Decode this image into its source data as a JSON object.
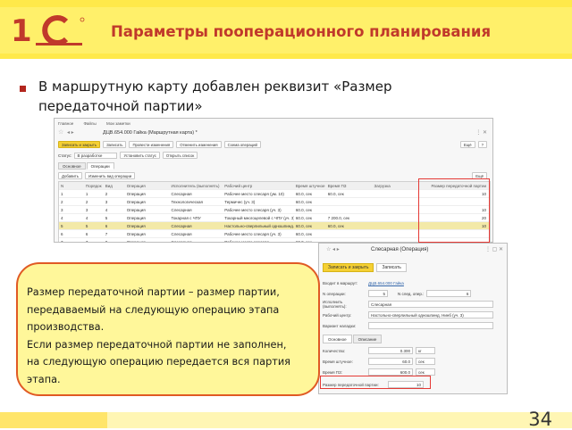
{
  "slide": {
    "title": "Параметры пооперационного планирования",
    "bullet": "В маршрутную карту добавлен реквизит «Размер передаточной партии»",
    "callout": [
      "Размер передаточной партии – размер партии,",
      "передаваемый на следующую операцию этапа",
      "производства.",
      "Если размер передаточной партии не заполнен,",
      "на следующую операцию передается вся партия",
      "этапа."
    ],
    "page_number": "34",
    "colors": {
      "title": "#c0392b",
      "accent": "#f5d033",
      "highlight_border": "#e53935",
      "callout_border": "#e05a24"
    }
  },
  "route_window": {
    "nav": [
      "Главное",
      "Файлы",
      "Мои заметки"
    ],
    "title": "ДЦВ.654.000 Гайка (Маршрутная карта) *",
    "toolbar": [
      "Записать и закрыть",
      "Записать",
      "Провести изменения",
      "Отменить изменения",
      "Схема операций"
    ],
    "toolbar_right": [
      "Ещё",
      "?"
    ],
    "status_label": "Статус:",
    "status_value": "В разработке",
    "status_buttons": [
      "Установить статус",
      "Открыть список"
    ],
    "tabs": [
      "Основное",
      "Операции"
    ],
    "grid_toolbar": [
      "Добавить",
      "Изменить вид операции"
    ],
    "grid_toolbar_right": [
      "Ещё"
    ],
    "columns": [
      "N",
      "Порядок",
      "Вид",
      "Операция",
      "Исполнитель (выполнять)",
      "Рабочий центр",
      "Время штучное",
      "Время ПЗ",
      "Загрузка",
      "Размер передаточной партии"
    ],
    "rows": [
      [
        "1",
        "1",
        "2",
        "Операция",
        "Слесарная",
        "Рабочее место слесаря (ум. 10)",
        "60.0, сек",
        "60.0, сек",
        "",
        "10"
      ],
      [
        "2",
        "2",
        "3",
        "Операция",
        "Технологическая",
        "Термичес (уч. 3)",
        "60.0, сек",
        "",
        "",
        ""
      ],
      [
        "3",
        "3",
        "4",
        "Операция",
        "Слесарная",
        "Рабочее место слесаря (уч. 3)",
        "60.0, сек",
        "",
        "",
        "10"
      ],
      [
        "4",
        "4",
        "5",
        "Операция",
        "Токарная с ЧПУ",
        "Токарный многоцелевой с ЧПУ (уч. 3)",
        "60.0, сек",
        "7 200.0, сек",
        "",
        "20"
      ],
      [
        "5",
        "5",
        "6",
        "Операция",
        "Слесарная",
        "Настольно-сверлильный одношпинд. (уч. 3)",
        "60.0, сек",
        "60.0, сек",
        "",
        "10"
      ],
      [
        "6",
        "6",
        "7",
        "Операция",
        "Слесарная",
        "Рабочее место слесаря (уч. 3)",
        "60.0, сек",
        "",
        "",
        ""
      ],
      [
        "7",
        "7",
        "8",
        "Операция",
        "Слесарная",
        "Рабочее место слесаря",
        "60.0, сек",
        "",
        "",
        ""
      ]
    ],
    "selected_row_index": 4
  },
  "operation_card": {
    "title": "Слесарная (Операция)",
    "buttons": [
      "Записать и закрыть",
      "Записать"
    ],
    "route_label": "Входит в маршрут:",
    "route_value": "ДЦВ.654.000 Гайка",
    "op_no_label": "N операции:",
    "op_no_value": "5",
    "next_label": "N след. опер.:",
    "next_value": "6",
    "executor_label": "Исполнить (выполнять):",
    "executor_value": "Слесарная",
    "workcenter_label": "Рабочий центр:",
    "workcenter_value": "Настольно-сверлильный одношпинд. Нинб (уч. 3)",
    "variant_label": "Вариант наладки:",
    "tabs": [
      "Основное",
      "Описание"
    ],
    "qty_label": "Количество:",
    "qty_value": "0.300",
    "qty_unit": "кг",
    "piece_label": "Время штучное:",
    "piece_value": "60.0",
    "piece_unit": "сек",
    "setup_label": "Время ПЗ:",
    "setup_value": "600.0",
    "setup_unit": "сек",
    "batch_label": "Размер передаточной партии:",
    "batch_value": "10"
  }
}
